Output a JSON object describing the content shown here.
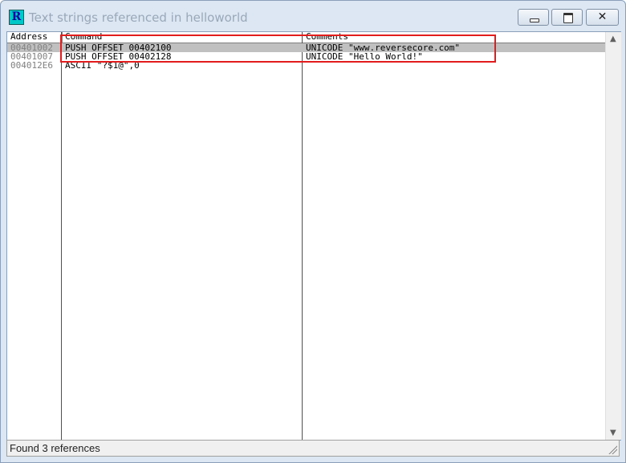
{
  "window": {
    "title": "Text strings referenced in helloworld",
    "icon_letter": "R",
    "buttons": {
      "minimize": "minimize",
      "maximize": "maximize",
      "close": "✕"
    }
  },
  "table": {
    "headers": {
      "address": "Address",
      "command": "Command",
      "comments": "Comments"
    },
    "rows": [
      {
        "address": "00401002",
        "command": "PUSH OFFSET 00402100",
        "comment": "UNICODE \"www.reversecore.com\"",
        "selected": true
      },
      {
        "address": "00401007",
        "command": "PUSH OFFSET 00402128",
        "comment": "UNICODE \"Hello World!\"",
        "selected": false
      },
      {
        "address": "004012E6",
        "command": "ASCII \"?$1@\",0",
        "comment": "",
        "selected": false
      }
    ]
  },
  "status": {
    "text": "Found 3 references"
  },
  "colors": {
    "highlight_box": "#e21c1c",
    "selected_row": "#c0c0c0",
    "address_text": "#808080"
  }
}
